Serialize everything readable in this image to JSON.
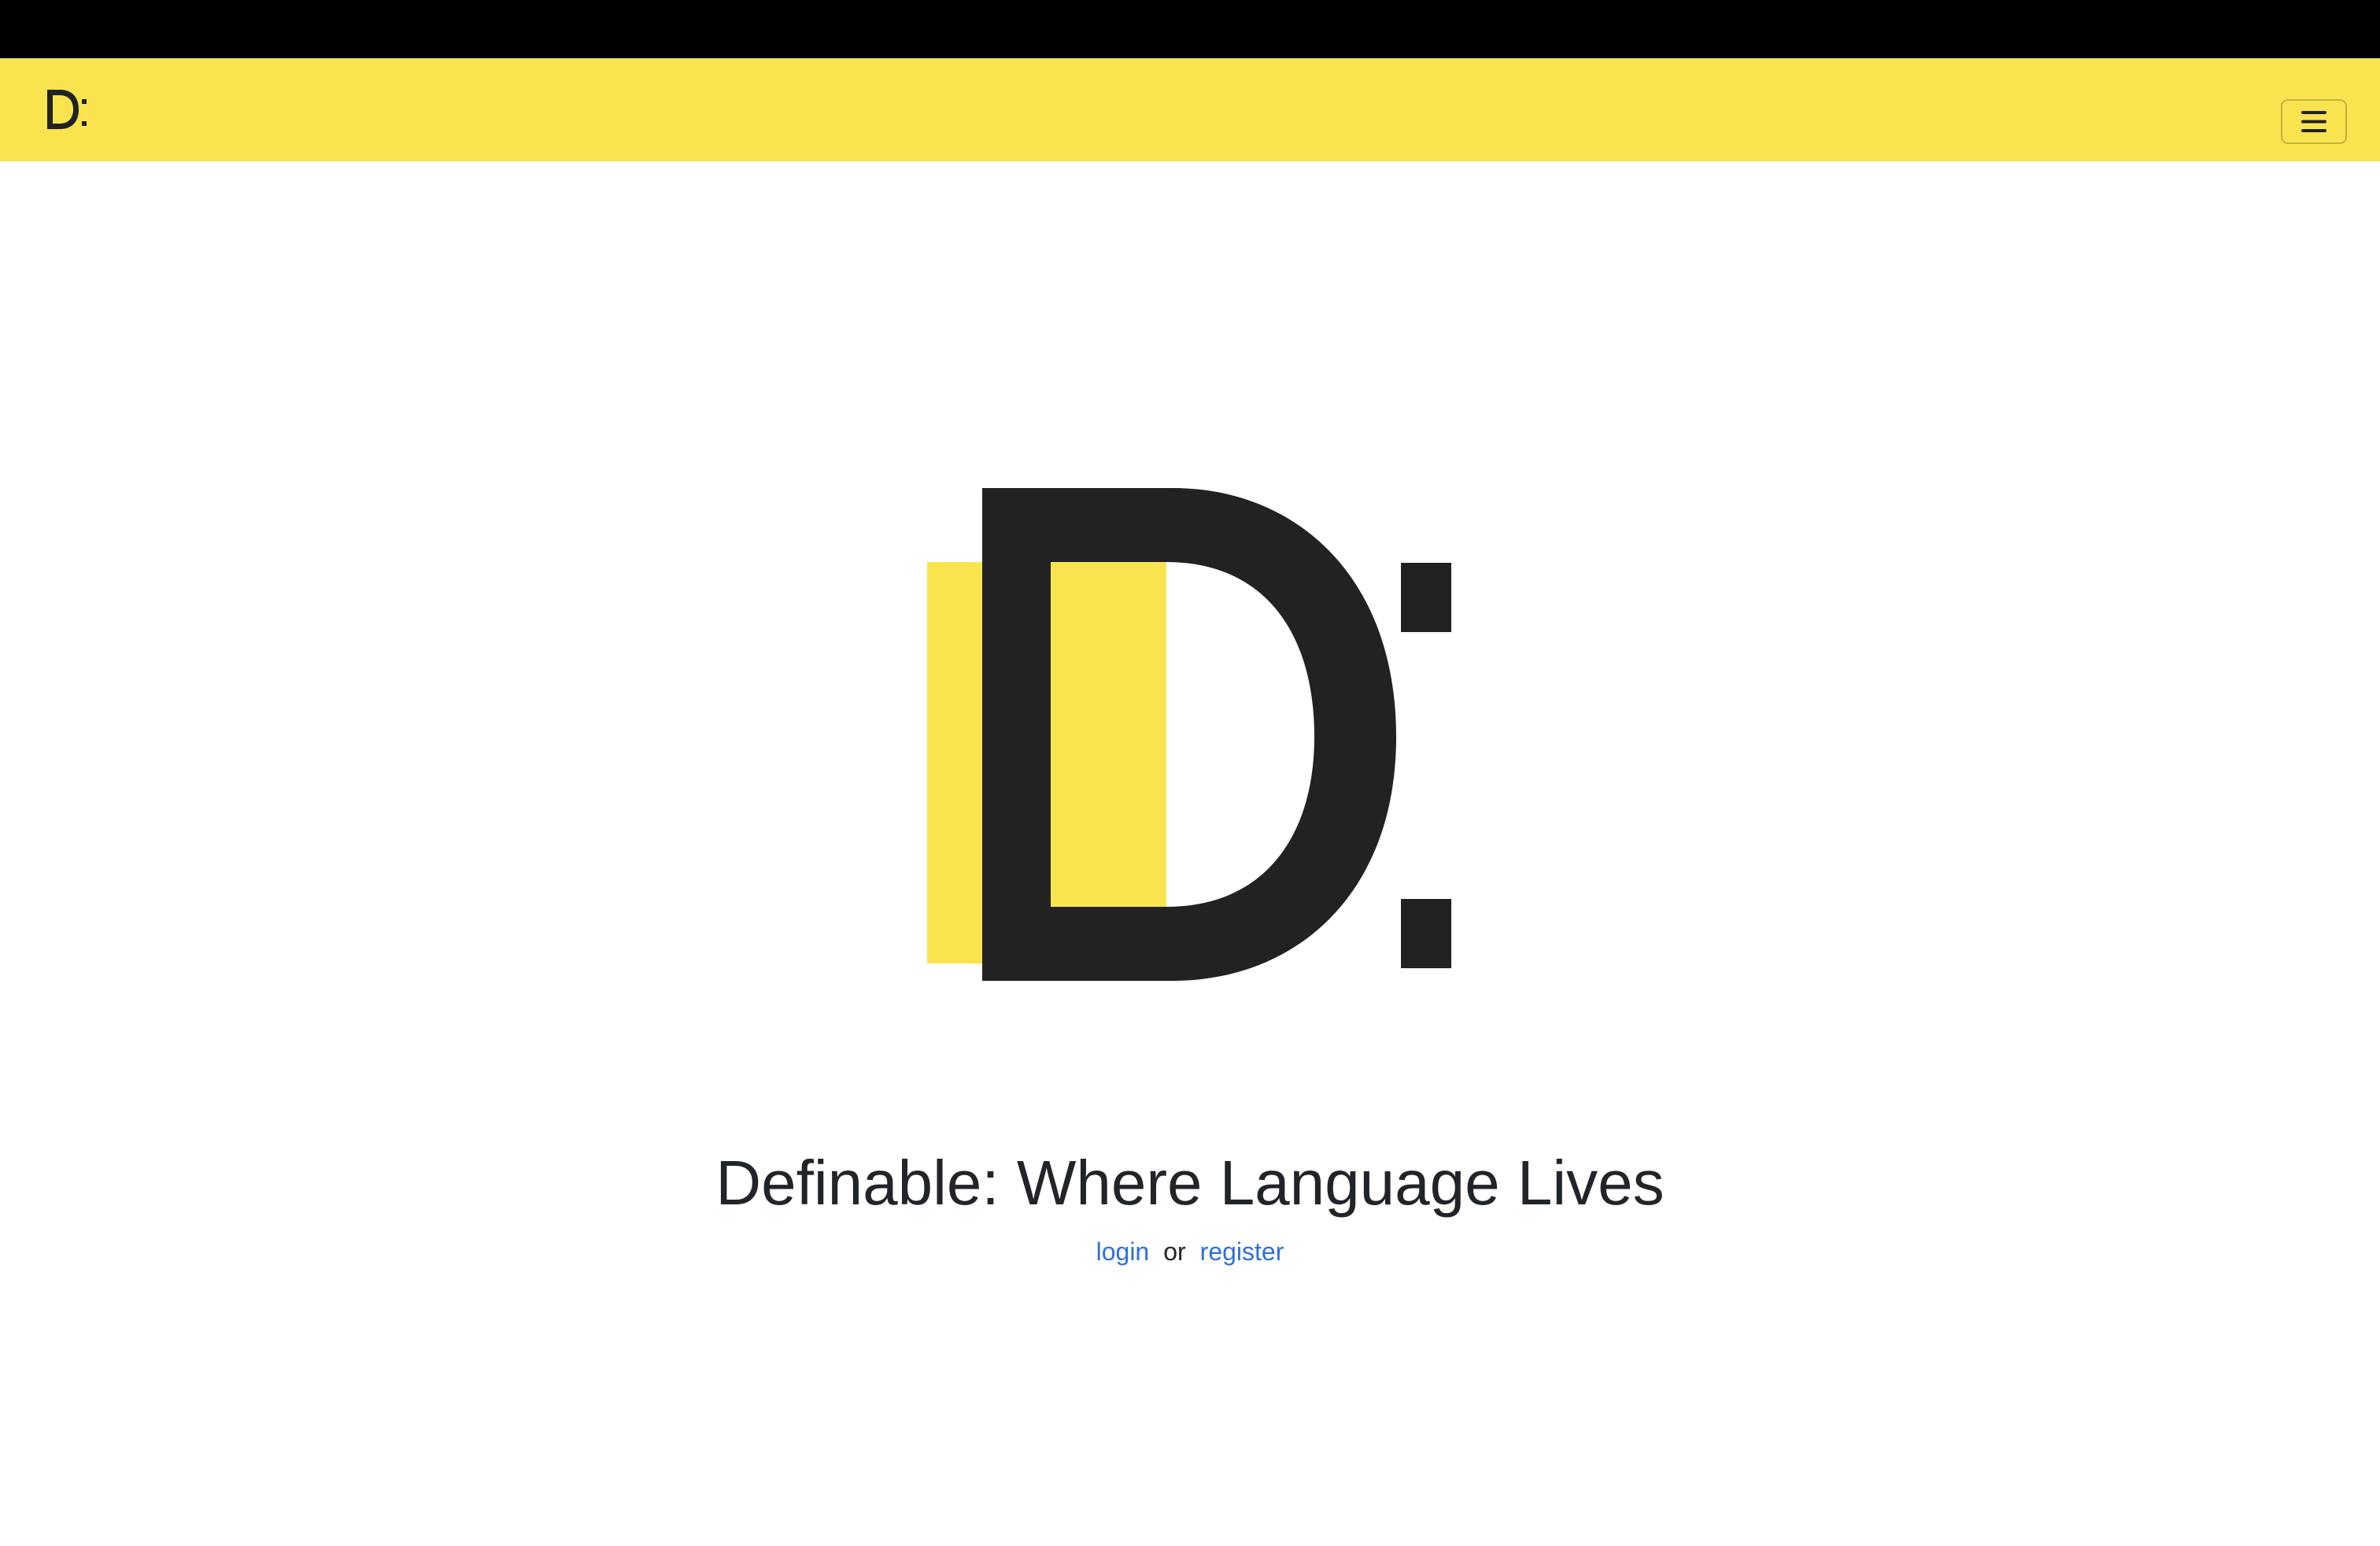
{
  "navbar": {
    "brand_icon": "definable-d-colon-logo",
    "menu_icon": "hamburger-menu-icon",
    "background_color": "#f9e450"
  },
  "hero": {
    "logo_icon": "definable-d-colon-logo",
    "title": "Definable: Where Language Lives"
  },
  "auth": {
    "login_label": "login",
    "separator": "or",
    "register_label": "register",
    "link_color": "#2f6fd9"
  },
  "colors": {
    "brand_yellow": "#f9e450",
    "ink": "#222222",
    "top_strip": "#000000"
  }
}
